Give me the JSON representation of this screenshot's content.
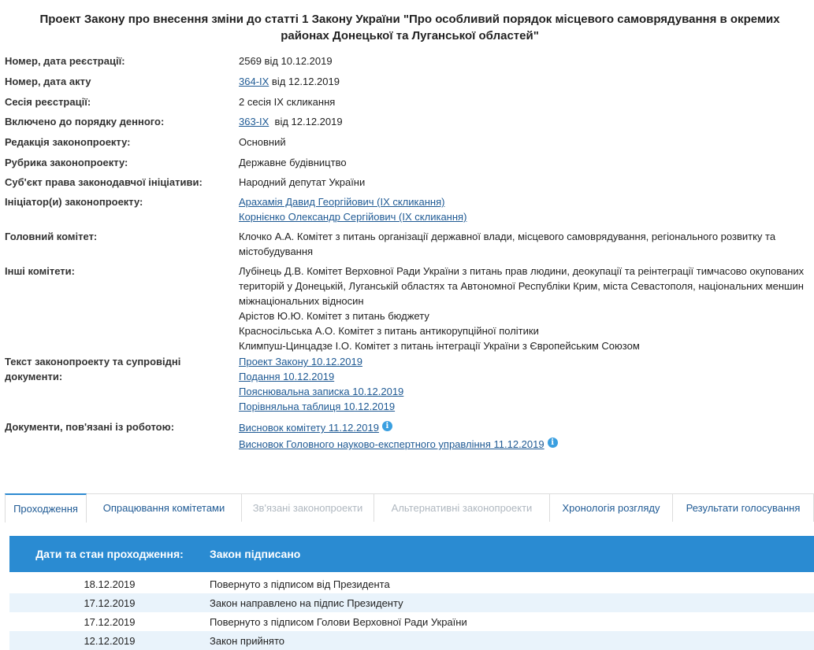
{
  "title": {
    "line1": "Проект Закону про внесення зміни до статті 1 Закону України \"Про особливий порядок місцевого самоврядування в окремих",
    "line2": "районах Донецької та Луганської областей\""
  },
  "fields": {
    "reg": {
      "label": "Номер, дата реєстрації:",
      "value": "2569 від 10.12.2019"
    },
    "act": {
      "label": "Номер, дата акту",
      "link": "364-IX",
      "rest": " від 12.12.2019"
    },
    "session": {
      "label": "Сесія реєстрації:",
      "value": "2 сесія IX скликання"
    },
    "agenda": {
      "label": "Включено до порядку денного:",
      "link": "363-IX",
      "rest": "  від 12.12.2019"
    },
    "edition": {
      "label": "Редакція законопроекту:",
      "value": "Основний"
    },
    "rubric": {
      "label": "Рубрика законопроекту:",
      "value": "Державне будівництво"
    },
    "subject": {
      "label": "Суб'єкт права законодавчої ініціативи:",
      "value": "Народний депутат України"
    },
    "initiators": {
      "label": "Ініціатор(и) законопроекту:",
      "items": [
        "Арахамія Давид Георгійович (IX скликання)",
        "Корнієнко Олександр Сергійович (IX скликання)"
      ]
    },
    "main_committee": {
      "label": "Головний комітет:",
      "line1": "Клочко А.А. Комітет з питань організації державної влади, місцевого самоврядування, регіонального розвитку та",
      "line2": "містобудування"
    },
    "other_committees": {
      "label": "Інші комітети:",
      "lines": [
        "Лубінець Д.В. Комітет Верховної Ради України з питань прав людини, деокупації та реінтеграції тимчасово окупованих",
        "територій у Донецькій, Луганській областях та Автономної Республіки Крим, міста Севастополя, національних меншин",
        "міжнаціональних відносин",
        "Арістов Ю.Ю. Комітет з питань бюджету",
        "Красносільська А.О. Комітет з питань антикорупційної політики",
        "Климпуш-Цинцадзе І.О. Комітет з питань інтеграції України з Європейським Союзом"
      ]
    },
    "texts": {
      "label_line1": "Текст законопроекту та супровідні",
      "label_line2": "документи:",
      "items": [
        "Проект Закону 10.12.2019",
        "Подання 10.12.2019",
        "Пояснювальна записка 10.12.2019",
        "Порівняльна таблиця 10.12.2019"
      ]
    },
    "related": {
      "label": "Документи, пов'язані із роботою:",
      "items": [
        "Висновок комітету 11.12.2019",
        "Висновок Головного науково-експертного управління 11.12.2019"
      ],
      "icon_glyph": "i"
    }
  },
  "tabs": [
    {
      "label": "Проходження",
      "state": "active"
    },
    {
      "label": "Опрацювання комітетами",
      "state": "normal"
    },
    {
      "label": "Зв'язані законопроекти",
      "state": "disabled"
    },
    {
      "label": "Альтернативні законопроекти",
      "state": "disabled"
    },
    {
      "label": "Хронологія розгляду",
      "state": "normal"
    },
    {
      "label": "Результати голосування",
      "state": "normal"
    }
  ],
  "status": {
    "label": "Дати та стан проходження:",
    "value": "Закон підписано"
  },
  "history": [
    {
      "date": "18.12.2019",
      "text": "Повернуто з підписом від Президента"
    },
    {
      "date": "17.12.2019",
      "text": "Закон направлено на підпис Президенту"
    },
    {
      "date": "17.12.2019",
      "text": "Повернуто з підписом Голови Верховної Ради України"
    },
    {
      "date": "12.12.2019",
      "text": "Закон прийнято"
    }
  ],
  "colors": {
    "accent": "#2a8bd2",
    "link": "#1f5a94",
    "alt_row": "#e9f3fb"
  }
}
